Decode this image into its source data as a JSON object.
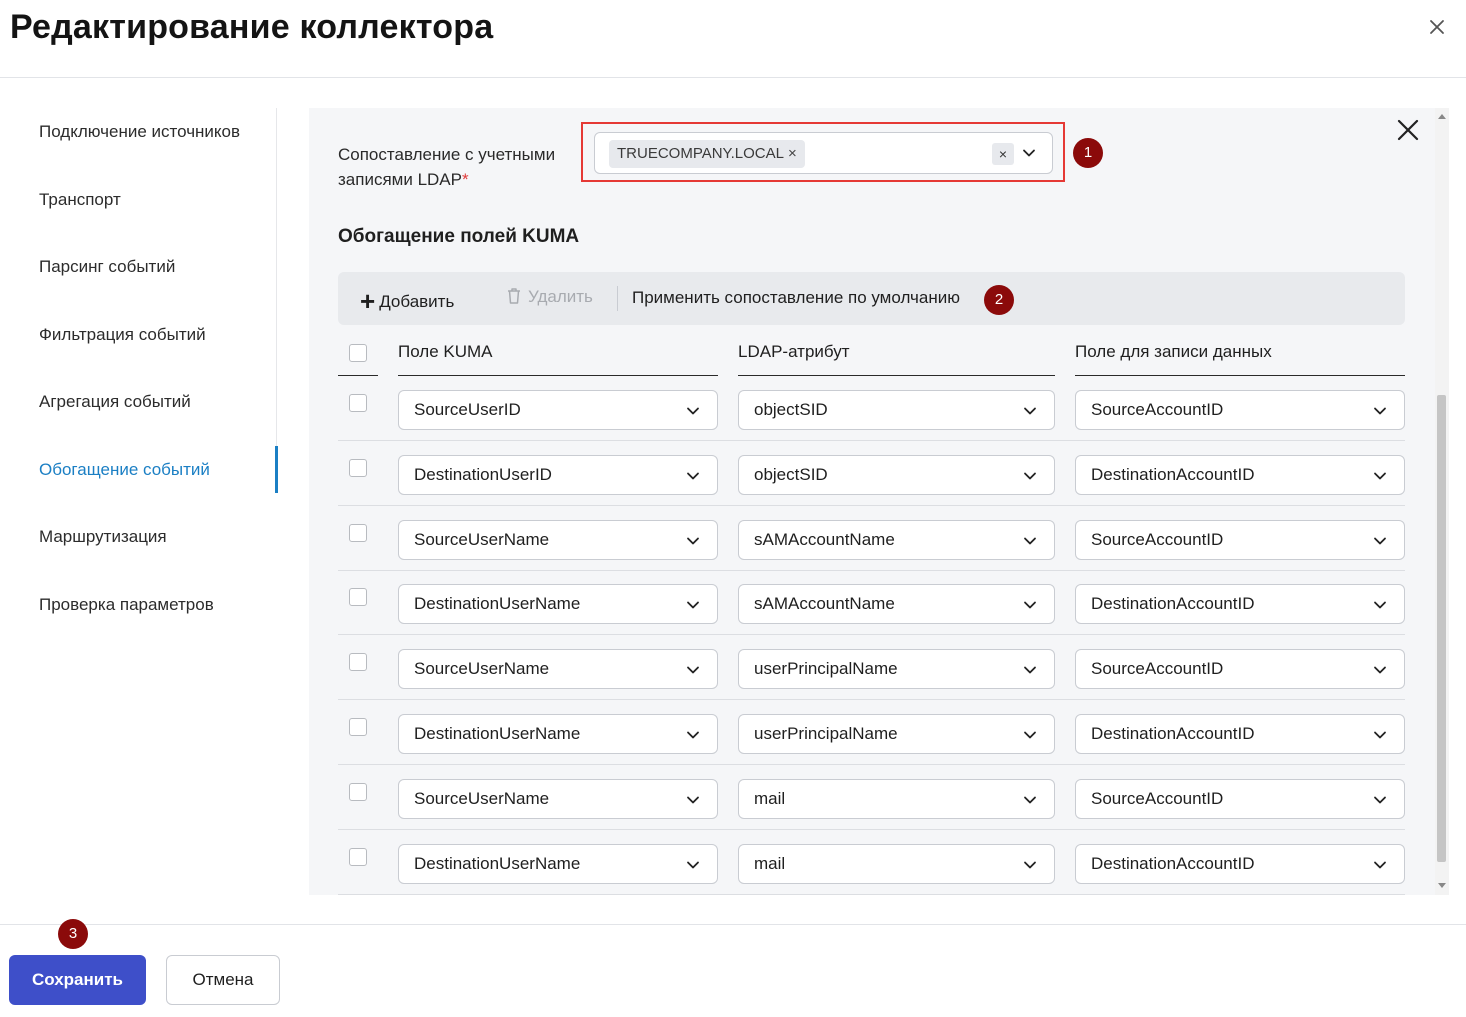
{
  "header": {
    "title": "Редактирование коллектора"
  },
  "sidebar": {
    "items": [
      {
        "label": "Подключение источников"
      },
      {
        "label": "Транспорт"
      },
      {
        "label": "Парсинг событий"
      },
      {
        "label": "Фильтрация событий"
      },
      {
        "label": "Агрегация событий"
      },
      {
        "label": "Обогащение событий",
        "active": true
      },
      {
        "label": "Маршрутизация"
      },
      {
        "label": "Проверка параметров"
      }
    ]
  },
  "panel": {
    "ldap_label": "Сопоставление с учетными записями LDAP",
    "ldap_required_mark": "*",
    "ldap_tag": "TRUECOMPANY.LOCAL",
    "ldap_tag_remove": "×",
    "clear_symbol": "×",
    "section_title": "Обогащение полей KUMA",
    "toolbar": {
      "add_label": "Добавить",
      "add_symbol": "+",
      "delete_label": "Удалить",
      "apply_default_label": "Применить сопоставление по умолчанию"
    },
    "table": {
      "columns": [
        "Поле KUMA",
        "LDAP-атрибут",
        "Поле для записи данных"
      ],
      "rows": [
        {
          "kuma": "SourceUserID",
          "ldap": "objectSID",
          "target": "SourceAccountID"
        },
        {
          "kuma": "DestinationUserID",
          "ldap": "objectSID",
          "target": "DestinationAccountID"
        },
        {
          "kuma": "SourceUserName",
          "ldap": "sAMAccountName",
          "target": "SourceAccountID"
        },
        {
          "kuma": "DestinationUserName",
          "ldap": "sAMAccountName",
          "target": "DestinationAccountID"
        },
        {
          "kuma": "SourceUserName",
          "ldap": "userPrincipalName",
          "target": "SourceAccountID"
        },
        {
          "kuma": "DestinationUserName",
          "ldap": "userPrincipalName",
          "target": "DestinationAccountID"
        },
        {
          "kuma": "SourceUserName",
          "ldap": "mail",
          "target": "SourceAccountID"
        },
        {
          "kuma": "DestinationUserName",
          "ldap": "mail",
          "target": "DestinationAccountID"
        }
      ]
    }
  },
  "annotations": {
    "badge1": "1",
    "badge2": "2",
    "badge3": "3"
  },
  "footer": {
    "save_label": "Сохранить",
    "cancel_label": "Отмена"
  },
  "colors": {
    "accent": "#1b7fc4",
    "primary_button": "#3e4fc9",
    "highlight": "#e53935",
    "badge": "#8b0a0a"
  }
}
